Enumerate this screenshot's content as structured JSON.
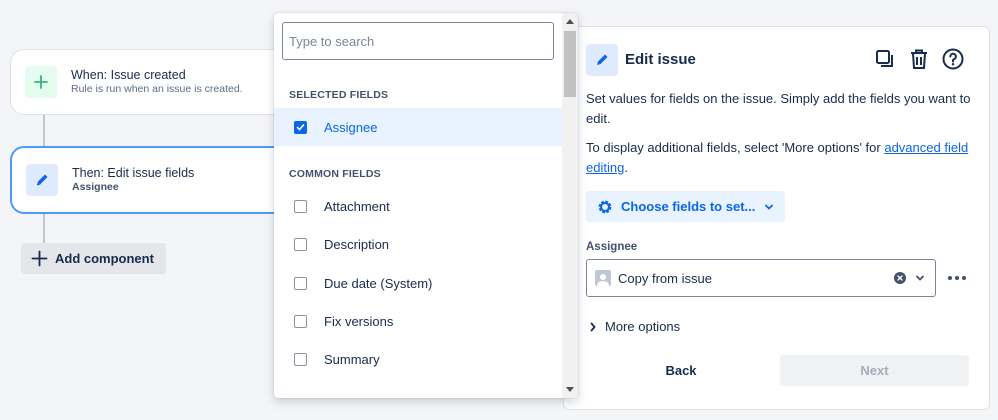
{
  "rule": {
    "trigger": {
      "title": "When: Issue created",
      "subtitle": "Rule is run when an issue is created.",
      "icon": "plus-icon"
    },
    "action": {
      "title": "Then: Edit issue fields",
      "subtitle": "Assignee",
      "icon": "pencil-icon"
    },
    "add_component_label": "Add component"
  },
  "dropdown": {
    "search_placeholder": "Type to search",
    "selected_heading": "SELECTED FIELDS",
    "selected_items": [
      {
        "label": "Assignee",
        "checked": true
      }
    ],
    "common_heading": "COMMON FIELDS",
    "common_items": [
      {
        "label": "Attachment",
        "checked": false
      },
      {
        "label": "Description",
        "checked": false
      },
      {
        "label": "Due date (System)",
        "checked": false
      },
      {
        "label": "Fix versions",
        "checked": false
      },
      {
        "label": "Summary",
        "checked": false
      }
    ]
  },
  "panel": {
    "title": "Edit issue",
    "description": "Set values for fields on the issue. Simply add the fields you want to edit.",
    "description2_prefix": "To display additional fields, select 'More options' for ",
    "description2_link": "advanced field editing",
    "description2_suffix": ".",
    "choose_fields_label": "Choose fields to set...",
    "field_label": "Assignee",
    "field_value": "Copy from issue",
    "more_options_label": "More options",
    "back_label": "Back",
    "next_label": "Next"
  },
  "colors": {
    "accent": "#0c66e4",
    "selected_bg": "#e9f2ff",
    "trigger_icon_bg": "#e3fcef",
    "action_icon_bg": "#deebff"
  }
}
